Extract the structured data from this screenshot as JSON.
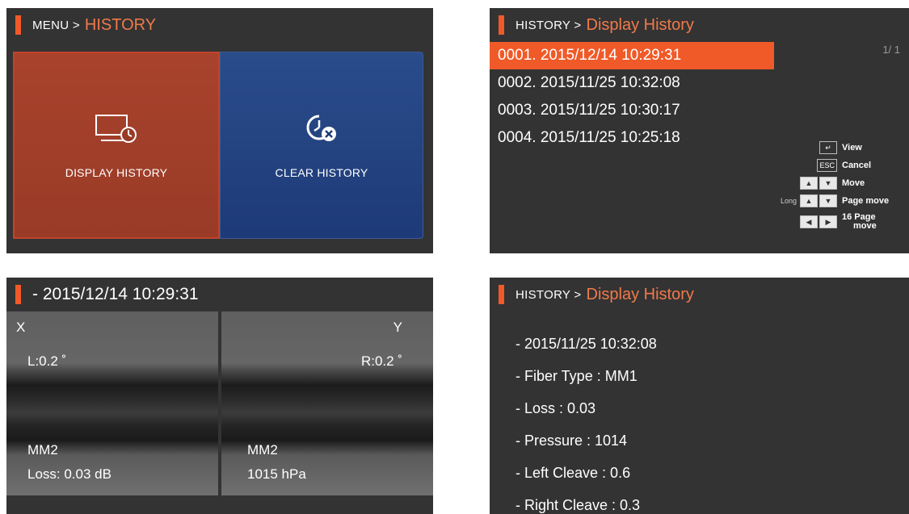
{
  "p1": {
    "breadcrumb": "MENU >",
    "title": "HISTORY",
    "tiles": [
      {
        "label": "DISPLAY HISTORY",
        "icon": "display-history-icon"
      },
      {
        "label": "CLEAR HISTORY",
        "icon": "clear-history-icon"
      }
    ]
  },
  "p2": {
    "breadcrumb": "HISTORY >",
    "title": "Display History",
    "pager": "1/ 1",
    "rows": [
      "0001. 2015/12/14  10:29:31",
      "0002. 2015/11/25  10:32:08",
      "0003. 2015/11/25  10:30:17",
      "0004. 2015/11/25  10:25:18"
    ],
    "keys": {
      "view": "View",
      "esc_key": "ESC",
      "cancel": "Cancel",
      "move": "Move",
      "long": "Long",
      "page_move": "Page move",
      "page16_a": "16 Page",
      "page16_b": "move"
    }
  },
  "p3": {
    "title": "- 2015/12/14 10:29:31",
    "left": {
      "axis": "X",
      "angle": "L:0.2 ˚",
      "type": "MM2",
      "stat": "Loss: 0.03 dB"
    },
    "right": {
      "axis": "Y",
      "angle": "R:0.2 ˚",
      "type": "MM2",
      "stat": "1015 hPa"
    }
  },
  "p4": {
    "breadcrumb": "HISTORY >",
    "title": "Display History",
    "lines": [
      "- 2015/11/25 10:32:08",
      "- Fiber Type : MM1",
      "- Loss : 0.03",
      "- Pressure : 1014",
      "- Left Cleave : 0.6",
      "- Right Cleave : 0.3"
    ]
  },
  "colors": {
    "accent": "#f05a28",
    "panel": "#333333",
    "clear_tile": "#1e3a78",
    "display_tile": "#993b27"
  }
}
